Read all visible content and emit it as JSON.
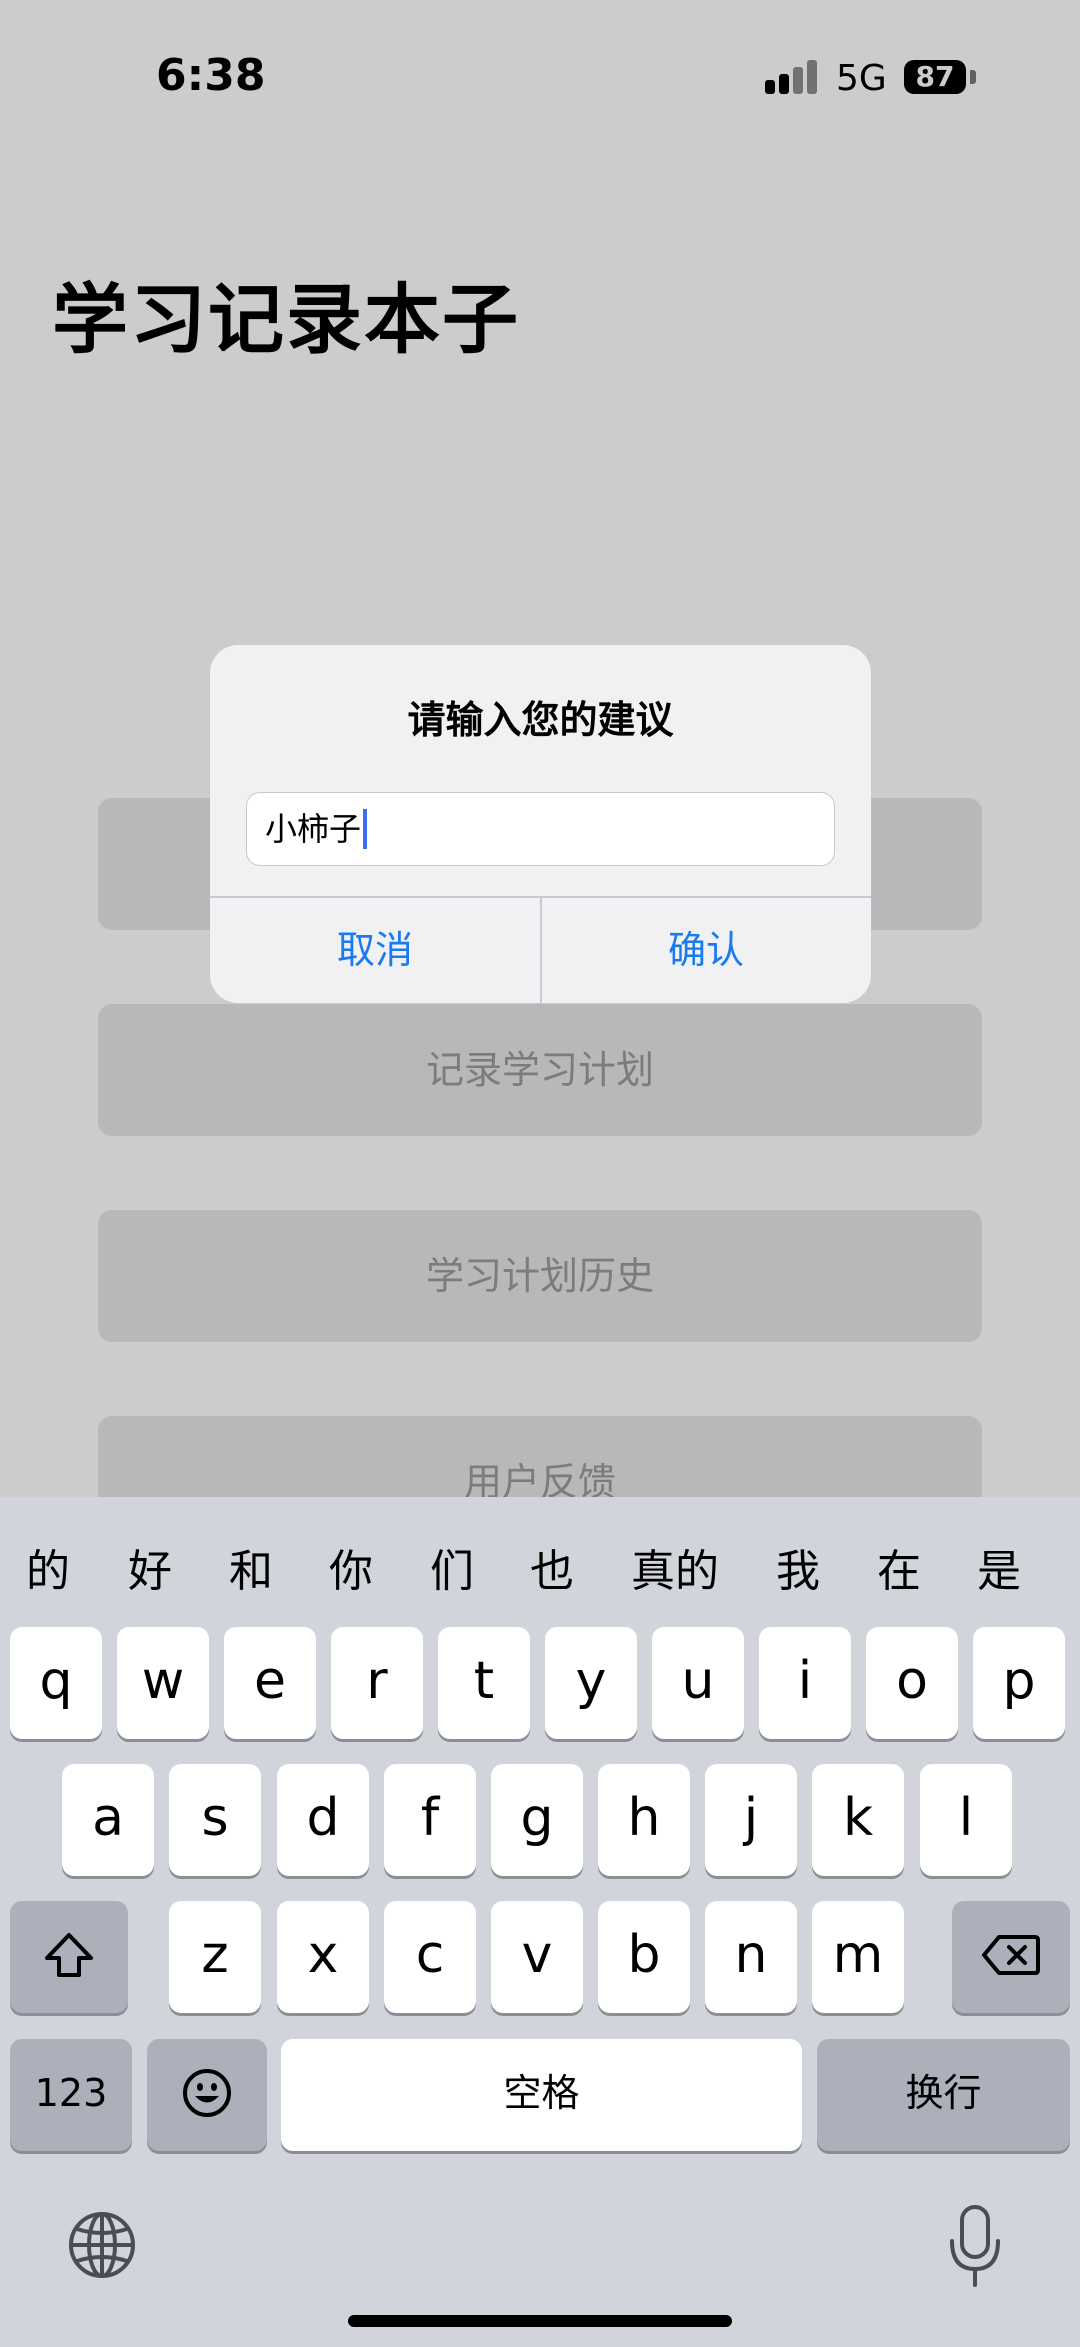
{
  "status_bar": {
    "time": "6:38",
    "network": "5G",
    "battery": "87",
    "signal_bars_active": 2,
    "signal_bars_total": 4
  },
  "app": {
    "title": "学习记录本子",
    "menu_buttons": [
      "记录学习计划",
      "学习计划历史",
      "用户反馈"
    ]
  },
  "alert": {
    "title": "请输入您的建议",
    "input_value": "小柿子",
    "cancel_label": "取消",
    "confirm_label": "确认"
  },
  "keyboard": {
    "candidates": [
      "的",
      "好",
      "和",
      "你",
      "们",
      "也",
      "真的",
      "我",
      "在",
      "是"
    ],
    "row1": [
      "q",
      "w",
      "e",
      "r",
      "t",
      "y",
      "u",
      "i",
      "o",
      "p"
    ],
    "row2": [
      "a",
      "s",
      "d",
      "f",
      "g",
      "h",
      "j",
      "k",
      "l"
    ],
    "row3": [
      "z",
      "x",
      "c",
      "v",
      "b",
      "n",
      "m"
    ],
    "numbers_label": "123",
    "space_label": "空格",
    "return_label": "换行"
  },
  "colors": {
    "accent": "#1a7bf0",
    "caret": "#3f6cf2"
  }
}
